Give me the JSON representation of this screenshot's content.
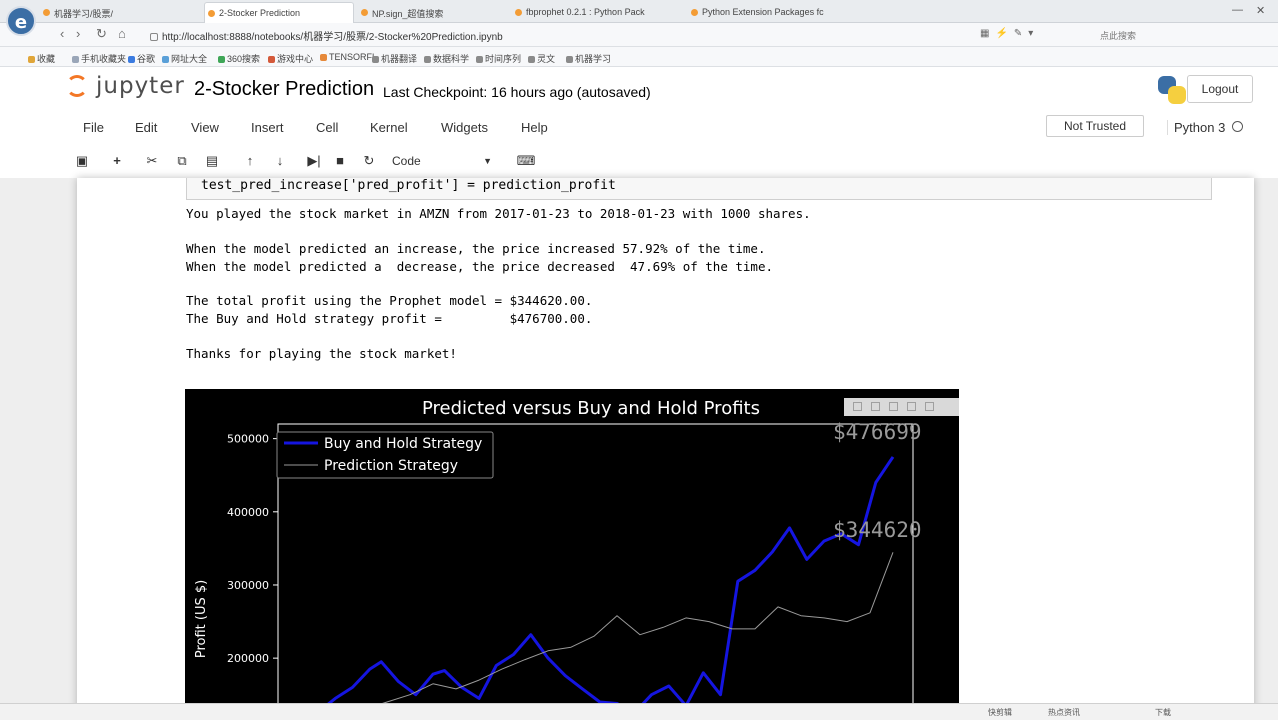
{
  "browser": {
    "tabs": [
      {
        "label": "机器学习/股票/",
        "active": false
      },
      {
        "label": "2-Stocker Prediction",
        "active": true
      },
      {
        "label": "NP.sign_超值搜索",
        "active": false
      },
      {
        "label": "fbprophet 0.2.1 : Python Pack",
        "active": false
      },
      {
        "label": "Python Extension Packages fc",
        "active": false
      }
    ],
    "url": "http://localhost:8888/notebooks/机器学习/股票/2-Stocker%20Prediction.ipynb",
    "search_placeholder": "点此搜索",
    "bookmarks": [
      "收藏",
      "手机收藏夹",
      "谷歌",
      "网址大全",
      "360搜索",
      "游戏中心",
      "TENSORFL",
      "机器翻译",
      "数据科学",
      "时间序列",
      "灵文",
      "机器学习"
    ]
  },
  "jupyter": {
    "logo_text": "jupyter",
    "notebook_title": "2-Stocker Prediction",
    "checkpoint": "Last Checkpoint: 16 hours ago (autosaved)",
    "logout_label": "Logout",
    "menu": [
      "File",
      "Edit",
      "View",
      "Insert",
      "Cell",
      "Kernel",
      "Widgets",
      "Help"
    ],
    "trust_status": "Not Trusted",
    "kernel_name": "Python 3",
    "cell_type": "Code"
  },
  "cell": {
    "code_line": "test_pred_increase['pred_profit'] = prediction_profit",
    "output_lines": [
      "You played the stock market in AMZN from 2017-01-23 to 2018-01-23 with 1000 shares.",
      "When the model predicted an increase, the price increased 57.92% of the time.",
      "When the model predicted a  decrease, the price decreased  47.69% of the time.",
      "The total profit using the Prophet model = $344620.00.",
      "The Buy and Hold strategy profit =         $476700.00.",
      "Thanks for playing the stock market!"
    ]
  },
  "chart_data": {
    "type": "line",
    "title": "Predicted versus Buy and Hold Profits",
    "ylabel": "Profit  (US $)",
    "xlabel": "",
    "ylim": [
      110000,
      520000
    ],
    "yticks": [
      200000,
      300000,
      400000,
      500000
    ],
    "ytick_labels": [
      "200000",
      "300000",
      "400000",
      "500000"
    ],
    "legend_position": "top-left",
    "grid": false,
    "background": "#000000",
    "series": [
      {
        "name": "Buy and Hold Strategy",
        "color": "#1515e0",
        "x": [
          0,
          3,
          6,
          9,
          11,
          14,
          17,
          20,
          22,
          25,
          28,
          31,
          34,
          37,
          40,
          43,
          46,
          49,
          52,
          55,
          58,
          61,
          64,
          67,
          70,
          73,
          76,
          79,
          82,
          85,
          88,
          91,
          94,
          97,
          100
        ],
        "values": [
          126000,
          145000,
          160000,
          185000,
          195000,
          168000,
          150000,
          178000,
          183000,
          160000,
          145000,
          190000,
          205000,
          232000,
          200000,
          176000,
          158000,
          140000,
          138000,
          125000,
          150000,
          162000,
          135000,
          180000,
          150000,
          305000,
          320000,
          345000,
          378000,
          335000,
          360000,
          370000,
          355000,
          440000,
          475000
        ]
      },
      {
        "name": "Prediction Strategy",
        "color": "#9a9a9a",
        "x": [
          0,
          4,
          8,
          12,
          16,
          20,
          24,
          28,
          32,
          36,
          40,
          44,
          48,
          52,
          56,
          60,
          64,
          68,
          72,
          76,
          80,
          84,
          88,
          92,
          96,
          100
        ],
        "values": [
          116000,
          122000,
          130000,
          140000,
          150000,
          165000,
          158000,
          170000,
          185000,
          198000,
          210000,
          215000,
          230000,
          258000,
          232000,
          242000,
          255000,
          250000,
          240000,
          240000,
          270000,
          258000,
          255000,
          250000,
          262000,
          344620
        ]
      }
    ],
    "annotations": [
      "$476699",
      "$344620"
    ]
  },
  "taskbar": {
    "items": [
      "快剪辑",
      "热点资讯",
      "下载"
    ]
  }
}
